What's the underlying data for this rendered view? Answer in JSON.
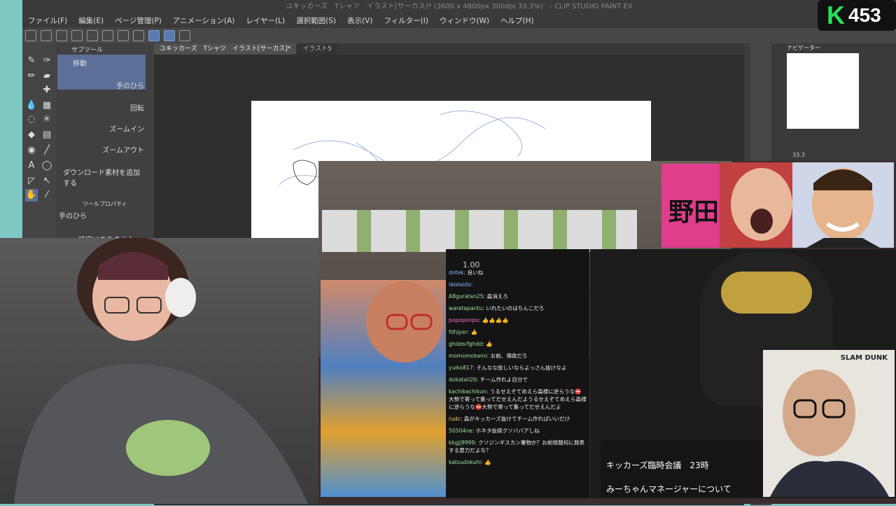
{
  "app": {
    "title": "ユキッカーズ　Tシャツ　イラスト[サーカス]* (3600 x 4800px 300dpi 33.3%)　- CLIP STUDIO PAINT EX",
    "menu": [
      "ファイル(F)",
      "編集(E)",
      "ページ管理(P)",
      "アニメーション(A)",
      "レイヤー(L)",
      "選択範囲(S)",
      "表示(V)",
      "フィルター(I)",
      "ウィンドウ(W)",
      "ヘルプ(H)"
    ],
    "tabs": [
      "ユキッカーズ　Tシャツ　イラスト[サーカス]*",
      "イラスト5"
    ],
    "subtool_header": "サブツール",
    "subtools": [
      "移動",
      "手のひら",
      "回転",
      "ズームイン",
      "ズームアウト"
    ],
    "add_material": "ダウンロード素材を追加する",
    "toolprop_header": "ツールプロパティ",
    "toolprop_name": "手のひら",
    "toolprop_empty": "設定はありません",
    "navigator_header": "ナビゲーター",
    "zoom": "33.3"
  },
  "overlay": {
    "badge_letter": "K",
    "badge_count": "453",
    "poster_text": "野田",
    "chat_rate": "1.00",
    "caption_line1": "キッカーズ臨時会議　23時",
    "caption_line2": "みーちゃんマネージャーについて",
    "chair_brand": "SLAM DUNK"
  },
  "chat": [
    {
      "user": "dotek",
      "msg": "良いね",
      "c": "b"
    },
    {
      "user": "lalalaidx",
      "msg": "",
      "c": "b"
    },
    {
      "user": "A8guratan25",
      "msg": "森消えろ",
      "c": ""
    },
    {
      "user": "waretapantu",
      "msg": "いれたいのはちんこだろ",
      "c": ""
    },
    {
      "user": "popoponpo",
      "msg": "👍👍👍👍",
      "c": "p"
    },
    {
      "user": "fdhjyer",
      "msg": "👍",
      "c": ""
    },
    {
      "user": "ghdesrfghdd",
      "msg": "👍",
      "c": ""
    },
    {
      "user": "momomokami",
      "msg": "お前、偉政だろ",
      "c": ""
    },
    {
      "user": "yuiko817",
      "msg": "そんなな欲しいならよっさん抜けなよ",
      "c": ""
    },
    {
      "user": "dokatali20",
      "msg": "チーム作れよ自分で",
      "c": ""
    },
    {
      "user": "kachikachikun",
      "msg": "うるせえぞてめえら森様に逆らうな⛔大勢で寄って集ってだせえんだようるせえぞてめえら森様に逆らうな⛔大勢で寄って集ってだせえんだよ",
      "c": ""
    },
    {
      "user": "rudc",
      "msg": "森がキッカーズ抜けてチーム作ればいいだけ",
      "c": "y"
    },
    {
      "user": "50504ne",
      "msg": "ホネタ仮病クソババアしね",
      "c": ""
    },
    {
      "user": "kkgjj9999",
      "msg": "クソジンギスカン薯物か？お前情報何に発表する意力だよな？",
      "c": ""
    },
    {
      "user": "katsudokuhi",
      "msg": "👍",
      "c": ""
    }
  ]
}
